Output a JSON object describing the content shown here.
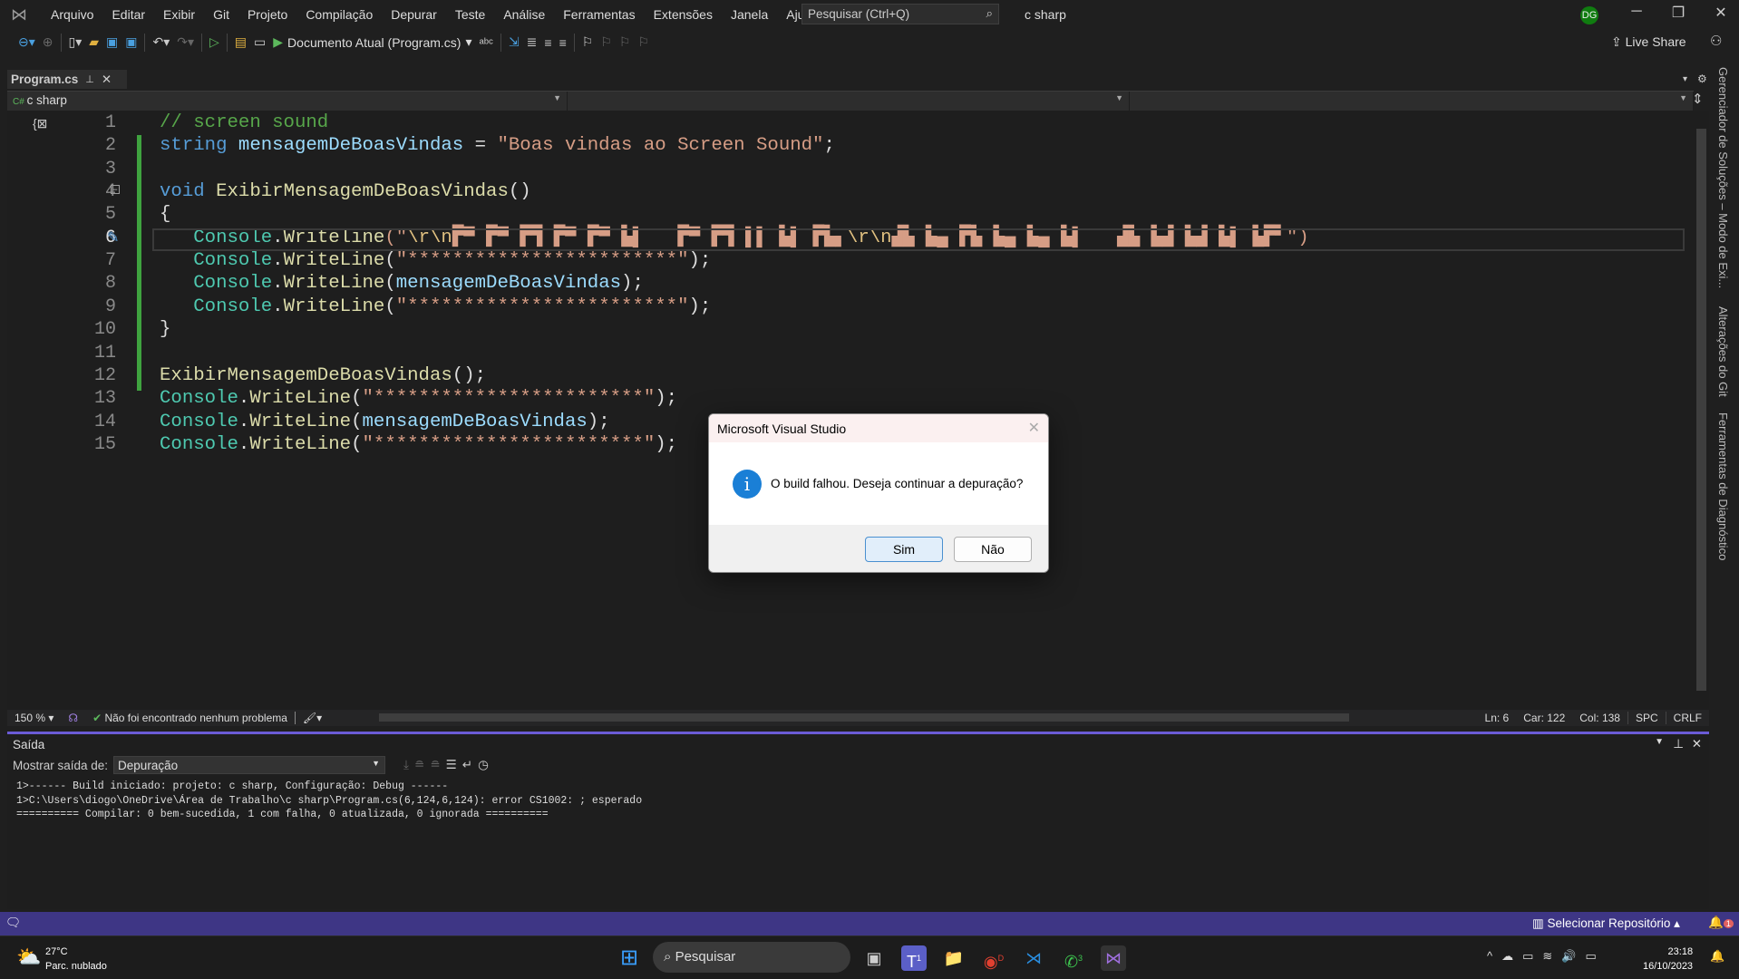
{
  "menubar": {
    "items": [
      "Arquivo",
      "Editar",
      "Exibir",
      "Git",
      "Projeto",
      "Compilação",
      "Depurar",
      "Teste",
      "Análise",
      "Ferramentas",
      "Extensões",
      "Janela",
      "Ajuda"
    ],
    "search_placeholder": "Pesquisar (Ctrl+Q)",
    "solution": "c sharp",
    "avatar": "DG"
  },
  "toolbar": {
    "run_target": "Documento Atual (Program.cs)",
    "live_share": "Live Share"
  },
  "tab": {
    "label": "Program.cs"
  },
  "nav": {
    "project": "c sharp"
  },
  "editor": {
    "current_line": 6,
    "lines": [
      [
        [
          "// screen sound",
          "cmt"
        ]
      ],
      [
        [
          "string ",
          "kw"
        ],
        [
          "mensagemDeBoasVindas",
          "id"
        ],
        [
          " = ",
          "pl"
        ],
        [
          "\"Boas vindas ao Screen Sound\"",
          "str"
        ],
        [
          ";",
          "pl"
        ]
      ],
      [],
      [
        [
          "void ",
          "kw"
        ],
        [
          "ExibirMensagemDeBoasVindas",
          "mth"
        ],
        [
          "()",
          "pl"
        ]
      ],
      [
        [
          "{",
          "pl"
        ]
      ],
      [
        [
          "   Console",
          "cls"
        ],
        [
          ".",
          "pl"
        ],
        [
          "Writeline",
          "mth"
        ],
        [
          "(\"",
          "str"
        ],
        [
          "\\r\\n",
          "esc"
        ],
        [
          "▛▀ ▛▀ ▛▜ ▛▀ ▛▀ ▙▌   ▛▀ ▛▜ ▌▌ ▙▌ ▛▙▖",
          "garble"
        ],
        [
          "\\r\\n",
          "esc"
        ],
        [
          "▟▙ ▙▄ ▛▙ ▙▄ ▙▄ ▙▌   ▟▙ ▙▟ ▙▟ ▙▌ ▙▛▘",
          "garble"
        ],
        [
          "\")",
          "str"
        ]
      ],
      [
        [
          "   Console",
          "cls"
        ],
        [
          ".",
          "pl"
        ],
        [
          "WriteLine",
          "mth"
        ],
        [
          "(",
          "pl"
        ],
        [
          "\"************************\"",
          "str"
        ],
        [
          ");",
          "pl"
        ]
      ],
      [
        [
          "   Console",
          "cls"
        ],
        [
          ".",
          "pl"
        ],
        [
          "WriteLine",
          "mth"
        ],
        [
          "(",
          "pl"
        ],
        [
          "mensagemDeBoasVindas",
          "id"
        ],
        [
          ");",
          "pl"
        ]
      ],
      [
        [
          "   Console",
          "cls"
        ],
        [
          ".",
          "pl"
        ],
        [
          "WriteLine",
          "mth"
        ],
        [
          "(",
          "pl"
        ],
        [
          "\"************************\"",
          "str"
        ],
        [
          ");",
          "pl"
        ]
      ],
      [
        [
          "}",
          "pl"
        ]
      ],
      [],
      [
        [
          "ExibirMensagemDeBoasVindas",
          "mth"
        ],
        [
          "();",
          "pl"
        ]
      ],
      [
        [
          "Console",
          "cls"
        ],
        [
          ".",
          "pl"
        ],
        [
          "WriteLine",
          "mth"
        ],
        [
          "(",
          "pl"
        ],
        [
          "\"************************\"",
          "str"
        ],
        [
          ");",
          "pl"
        ]
      ],
      [
        [
          "Console",
          "cls"
        ],
        [
          ".",
          "pl"
        ],
        [
          "WriteLine",
          "mth"
        ],
        [
          "(",
          "pl"
        ],
        [
          "mensagemDeBoasVindas",
          "id"
        ],
        [
          ");",
          "pl"
        ]
      ],
      [
        [
          "Console",
          "cls"
        ],
        [
          ".",
          "pl"
        ],
        [
          "WriteLine",
          "mth"
        ],
        [
          "(",
          "pl"
        ],
        [
          "\"************************\"",
          "str"
        ],
        [
          ");",
          "pl"
        ]
      ]
    ]
  },
  "editor_status": {
    "zoom": "150 %",
    "issues": "Não foi encontrado nenhum problema",
    "ln": "Ln: 6",
    "car": "Car: 122",
    "col": "Col: 138",
    "spc": "SPC",
    "eol": "CRLF"
  },
  "output": {
    "title": "Saída",
    "show_from_label": "Mostrar saída de:",
    "source": "Depuração",
    "lines": [
      "1>------ Build iniciado: projeto: c sharp, Configuração: Debug ------",
      "1>C:\\Users\\diogo\\OneDrive\\Área de Trabalho\\c sharp\\Program.cs(6,124,6,124): error CS1002: ; esperado",
      "========== Compilar: 0 bem-sucedida, 1 com falha, 0 atualizada, 0 ignorada =========="
    ]
  },
  "side_tabs": [
    "Gerenciador de Soluções – Modo de Exi...",
    "Alterações do Git",
    "Ferramentas de Diagnóstico"
  ],
  "status": {
    "repo": "Selecionar Repositório",
    "notifications": "1"
  },
  "dialog": {
    "title": "Microsoft Visual Studio",
    "message": "O build falhou. Deseja continuar a depuração?",
    "yes": "Sim",
    "no": "Não"
  },
  "taskbar": {
    "temp": "27°C",
    "weather": "Parc. nublado",
    "search": "Pesquisar",
    "time": "23:18",
    "date": "16/10/2023",
    "badges": {
      "teams": "1",
      "chrome": "D",
      "whatsapp": "3"
    }
  },
  "colors": {
    "accent": "#6b5bd6",
    "status_bar": "#3e3685",
    "git_change": "#3fa33f",
    "string": "#d69d85"
  }
}
